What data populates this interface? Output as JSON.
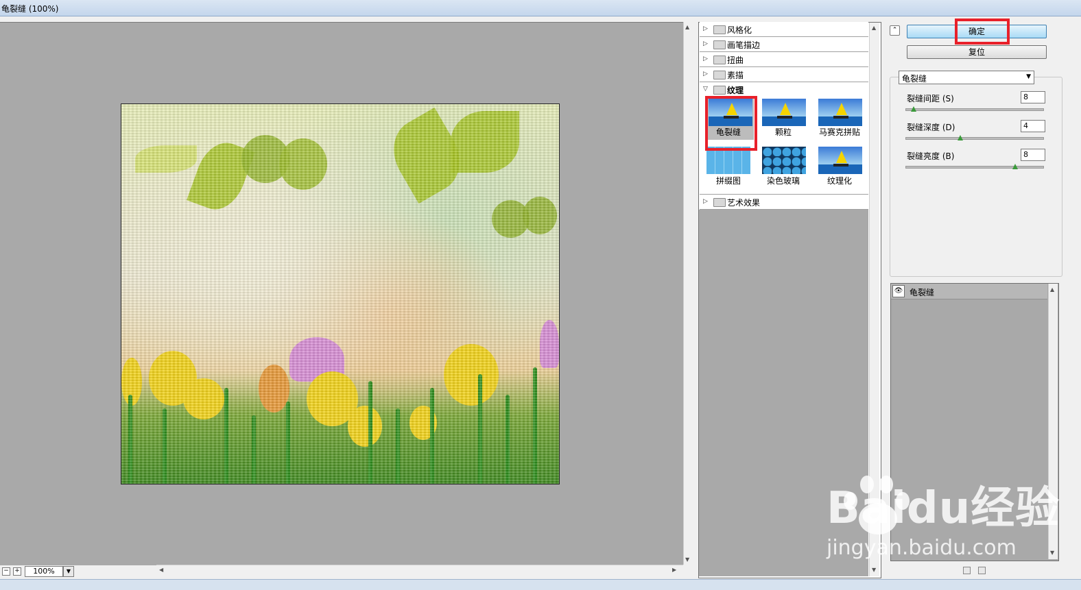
{
  "window": {
    "title": "龟裂缝 (100%)"
  },
  "preview": {
    "zoom": "100%"
  },
  "gallery": {
    "categories_top": [
      {
        "label": "风格化"
      },
      {
        "label": "画笔描边"
      },
      {
        "label": "扭曲"
      },
      {
        "label": "素描"
      }
    ],
    "open_category": "纹理",
    "filters": [
      {
        "label": "龟裂缝",
        "selected": true
      },
      {
        "label": "颗粒"
      },
      {
        "label": "马赛克拼贴"
      },
      {
        "label": "拼缀图"
      },
      {
        "label": "染色玻璃"
      },
      {
        "label": "纹理化"
      }
    ],
    "categories_bottom": [
      {
        "label": "艺术效果"
      }
    ]
  },
  "controls": {
    "ok_label": "确定",
    "reset_label": "复位",
    "filter_select": "龟裂缝",
    "params": [
      {
        "label": "裂缝间距 (S)",
        "value": "8",
        "fraction": 0.06
      },
      {
        "label": "裂缝深度 (D)",
        "value": "4",
        "fraction": 0.4
      },
      {
        "label": "裂缝亮度 (B)",
        "value": "8",
        "fraction": 0.8
      }
    ],
    "layer_name": "龟裂缝"
  },
  "watermark": {
    "brand": "Baidu经验",
    "url": "jingyan.baidu.com"
  },
  "colors": {
    "highlight": "#e8202a",
    "ok_button": "#a9dbf6",
    "canvas_bg": "#a9a9a9"
  }
}
